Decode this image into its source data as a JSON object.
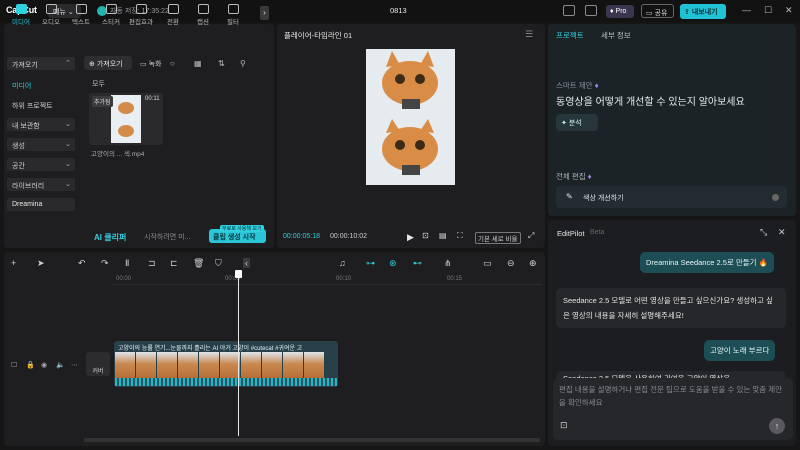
{
  "app": {
    "logo": "CapCut",
    "menu_label": "메뉴",
    "autosave": "자동 저장: 17:35:22",
    "project_name": "0813"
  },
  "header": {
    "pro_label": "Pro",
    "share_label": "공유",
    "export_label": "내보내기"
  },
  "media_tabs": [
    {
      "label": "미디어",
      "icon": "media-icon",
      "active": true
    },
    {
      "label": "오디오",
      "icon": "audio-icon"
    },
    {
      "label": "텍스트",
      "icon": "text-icon"
    },
    {
      "label": "스티커",
      "icon": "sticker-icon"
    },
    {
      "label": "편집효과",
      "icon": "effects-icon"
    },
    {
      "label": "전환",
      "icon": "transition-icon"
    },
    {
      "label": "캡션",
      "icon": "caption-icon"
    },
    {
      "label": "필터",
      "icon": "filter-icon"
    }
  ],
  "sidebar": {
    "import_head": "가져오기",
    "items": [
      "미디어",
      "하위 프로젝트",
      "내 보관함",
      "생성",
      "공간",
      "라이브러리",
      "Dreamina"
    ]
  },
  "media": {
    "import_btn": "가져오기",
    "record_btn": "녹화",
    "all_label": "모두",
    "added_badge": "추가됨",
    "duration": "00:11",
    "file_name": "고양이의 ... 섹.mp4"
  },
  "ai_bar": {
    "label": "AI 클리퍼",
    "placeholder": "시작하려면 미...",
    "generate": "클립 생성 시작",
    "promo": "무료로 사용해 보기"
  },
  "player": {
    "title": "플레이어-타임라인 01",
    "time_current": "00:00:05:18",
    "time_total": "00:00:10:02",
    "ratio": "기본 세로 비율"
  },
  "right_tabs": [
    {
      "label": "프로젝트",
      "active": true
    },
    {
      "label": "세부 정보"
    }
  ],
  "smart": {
    "label": "스마트 제안",
    "question": "동영상을 어떻게 개선할 수 있는지 알아보세요",
    "analyze": "분석",
    "full_edit": "전체 편집",
    "color_improve": "색상 개선하기"
  },
  "editpilot": {
    "title": "EditPilot",
    "beta": "Beta",
    "messages": [
      {
        "role": "user",
        "text": "Dreamina Seedance 2.5로 만들기 🔥"
      },
      {
        "role": "ai",
        "text": "Seedance 2.5 모델로 어떤 영상을 만들고 싶으신가요? 생성하고 싶은 영상의 내용을 자세히 설명해주세요!"
      },
      {
        "role": "user",
        "text": "고양이 노래 부르다"
      },
      {
        "role": "ai",
        "text": "Seedance 2.5 모델을 사용하여 귀여운 고양이 영상을"
      }
    ],
    "input_placeholder": "편집 내용을 설명하거나 편집 전문 팁으로 도움을 받을 수 있는 맞춤 제안을 확인하세요"
  },
  "timeline": {
    "ticks": [
      "00:00",
      "00:05",
      "00:10",
      "00:15"
    ],
    "cover_label": "커버",
    "clip_text": "고양이의 능률 연기...눈물까지 흘리는 AI 야거 고양이 #cutecat #귀여운 고"
  },
  "colors": {
    "accent": "#2fd0e0",
    "export": "#20c3d6",
    "clip": "#27404a"
  }
}
